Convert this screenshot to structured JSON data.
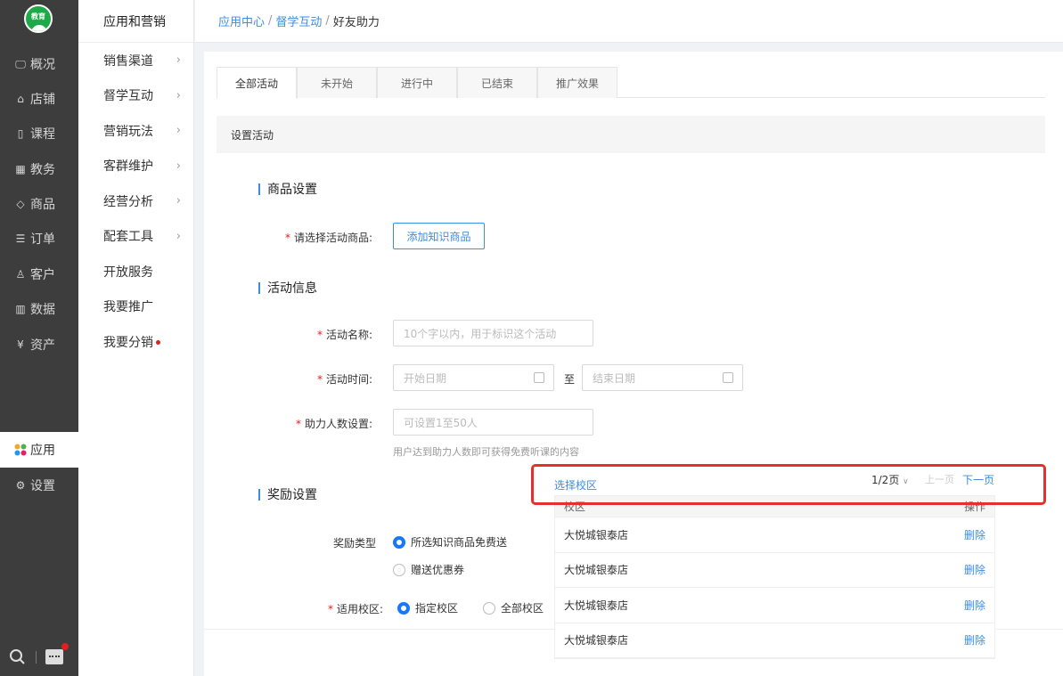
{
  "left_nav": {
    "logo_text": "教育",
    "items": [
      {
        "icon": "monitor-icon",
        "glyph": "🖵",
        "label": "概况"
      },
      {
        "icon": "store-icon",
        "glyph": "⌂",
        "label": "店铺"
      },
      {
        "icon": "book-icon",
        "glyph": "▯",
        "label": "课程"
      },
      {
        "icon": "calendar-icon",
        "glyph": "▦",
        "label": "教务"
      },
      {
        "icon": "tag-icon",
        "glyph": "◇",
        "label": "商品"
      },
      {
        "icon": "list-icon",
        "glyph": "☰",
        "label": "订单"
      },
      {
        "icon": "user-icon",
        "glyph": "♙",
        "label": "客户"
      },
      {
        "icon": "chart-icon",
        "glyph": "▥",
        "label": "数据"
      },
      {
        "icon": "yen-icon",
        "glyph": "¥",
        "label": "资产"
      },
      {
        "icon": "app-grid-icon",
        "glyph": "✿",
        "label": "应用"
      },
      {
        "icon": "gear-icon",
        "glyph": "⚙",
        "label": "设置"
      }
    ]
  },
  "sub_nav": {
    "title": "应用和营销",
    "items": [
      {
        "label": "销售渠道",
        "arrow": "›"
      },
      {
        "label": "督学互动",
        "arrow": "›"
      },
      {
        "label": "营销玩法",
        "arrow": "›"
      },
      {
        "label": "客群维护",
        "arrow": "›"
      },
      {
        "label": "经营分析",
        "arrow": "›"
      },
      {
        "label": "配套工具",
        "arrow": "›"
      },
      {
        "label": "开放服务",
        "arrow": ""
      },
      {
        "label": "我要推广",
        "arrow": ""
      },
      {
        "label": "我要分销",
        "arrow": ""
      }
    ]
  },
  "breadcrumb": {
    "a": "应用中心",
    "b": "督学互动",
    "c": "好友助力",
    "sep": "/"
  },
  "tabs": [
    "全部活动",
    "未开始",
    "进行中",
    "已结束",
    "推广效果"
  ],
  "section_title": "设置活动",
  "product": {
    "heading": "商品设置",
    "label": "请选择活动商品:",
    "button": "添加知识商品"
  },
  "activity": {
    "heading": "活动信息",
    "name_label": "活动名称:",
    "name_placeholder": "10个字以内，用于标识这个活动",
    "time_label": "活动时间:",
    "start_placeholder": "开始日期",
    "to": "至",
    "end_placeholder": "结束日期",
    "helpers_label": "助力人数设置:",
    "helpers_placeholder": "可设置1至50人",
    "helpers_hint": "用户达到助力人数即可获得免费听课的内容"
  },
  "reward": {
    "heading": "奖励设置",
    "type_label": "奖励类型",
    "opt1": "所选知识商品免费送",
    "opt2": "赠送优惠券",
    "campus_label": "适用校区:",
    "campus_opt1": "指定校区",
    "campus_opt2": "全部校区"
  },
  "popup": {
    "select_link": "选择校区",
    "page_info": "1/2页",
    "prev": "上一页",
    "next": "下一页",
    "col_campus": "校区",
    "col_action": "操作",
    "rows": [
      {
        "name": "大悦城银泰店",
        "action": "删除"
      },
      {
        "name": "大悦城银泰店",
        "action": "删除"
      },
      {
        "name": "大悦城银泰店",
        "action": "删除"
      },
      {
        "name": "大悦城银泰店",
        "action": "删除"
      }
    ]
  }
}
